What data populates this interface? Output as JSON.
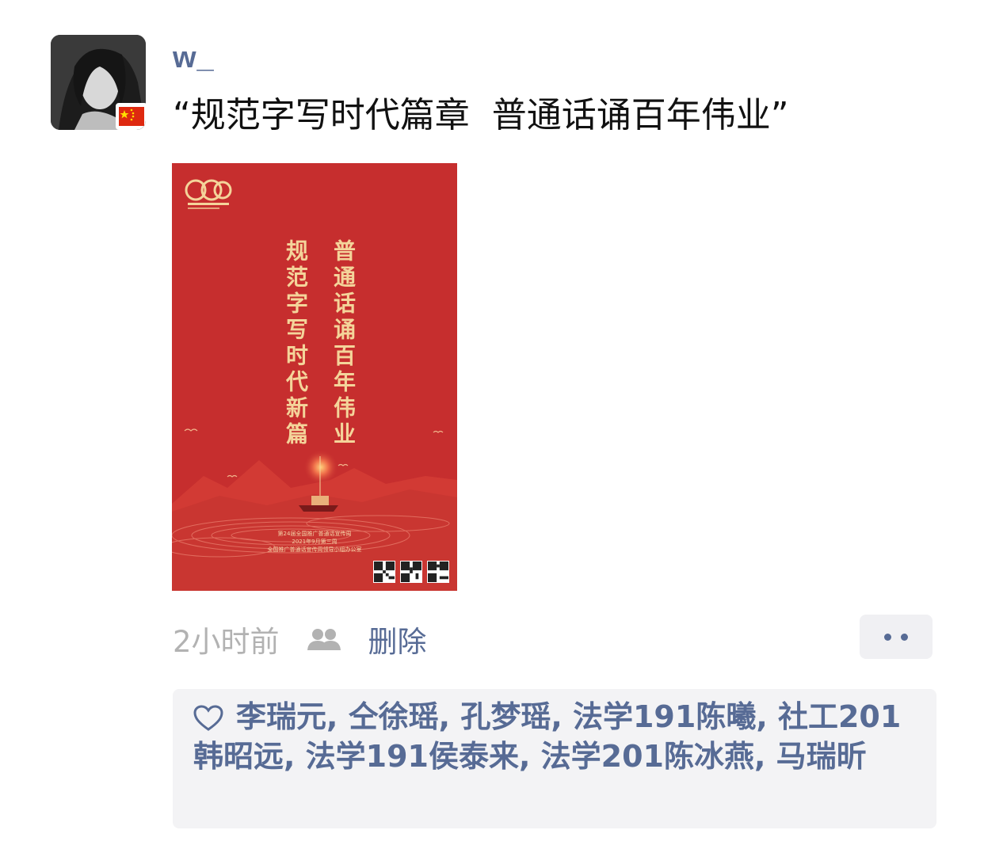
{
  "post": {
    "author": "w_",
    "text": "“规范字写时代篇章  普通话诵百年伟业”",
    "time": "2小时前",
    "delete_label": "删除",
    "likes_text": "李瑞元, 仝徐瑶, 孔梦瑶, 法学191陈曦, 社工201韩昭远, 法学191侯泰来, 法学201陈冰燕, 马瑞昕"
  },
  "poster": {
    "col_right": "普通话诵百年伟业",
    "col_left": "规范字写时代新篇",
    "line1": "第24届全国推广普通话宣传周",
    "line2": "2021年9月第三周",
    "line3": "全国推广普通话宣传周领导小组办公室"
  },
  "colors": {
    "link": "#576b95",
    "poster_red": "#c62e2e",
    "gold": "#f4d49a"
  },
  "icons": [
    "flag-icon",
    "friends-icon",
    "more-icon",
    "heart-icon"
  ]
}
